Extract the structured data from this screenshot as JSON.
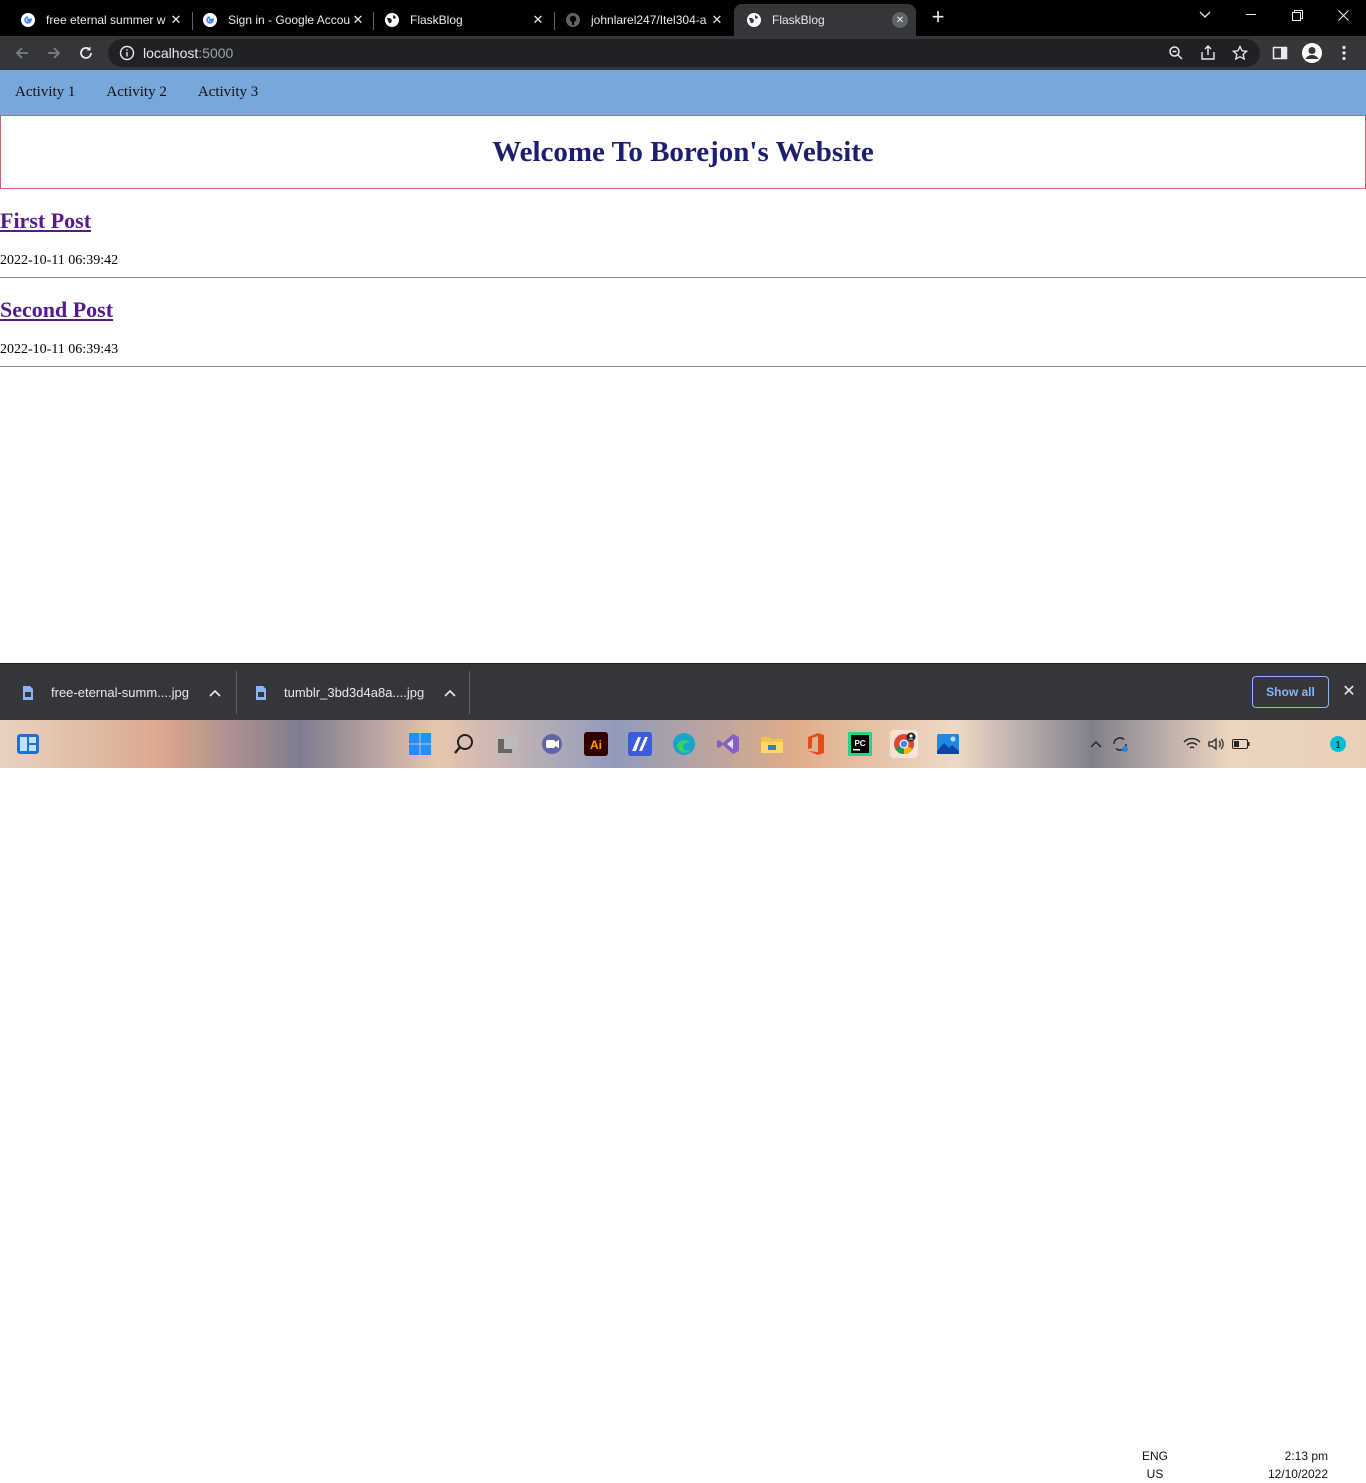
{
  "browser": {
    "tabs": [
      {
        "title": "free eternal summer w",
        "icon": "google-g-icon",
        "active": false
      },
      {
        "title": "Sign in - Google Accou",
        "icon": "google-g-icon",
        "active": false
      },
      {
        "title": "FlaskBlog",
        "icon": "globe-icon",
        "active": false
      },
      {
        "title": "johnlarel247/Itel304-a",
        "icon": "github-icon",
        "active": false
      },
      {
        "title": "FlaskBlog",
        "icon": "globe-icon",
        "active": true
      }
    ],
    "url_host": "localhost",
    "url_port": ":5000"
  },
  "site": {
    "nav": [
      "Activity 1",
      "Activity 2",
      "Activity 3"
    ],
    "heading": "Welcome To Borejon's Website",
    "posts": [
      {
        "title": "First Post",
        "created": "2022-10-11 06:39:42"
      },
      {
        "title": "Second Post",
        "created": "2022-10-11 06:39:43"
      }
    ]
  },
  "downloads": {
    "items": [
      {
        "name": "free-eternal-summ....jpg"
      },
      {
        "name": "tumblr_3bd3d4a8a....jpg"
      }
    ],
    "show_all": "Show all"
  },
  "taskbar": {
    "lang_top": "ENG",
    "lang_bottom": "US",
    "time": "2:13 pm",
    "date": "12/10/2022",
    "notification_count": "1"
  },
  "colors": {
    "nav_bg": "#78a8da",
    "heading": "#1e1e6e",
    "link_visited": "#551a8b",
    "banner_border": "#c66670"
  }
}
